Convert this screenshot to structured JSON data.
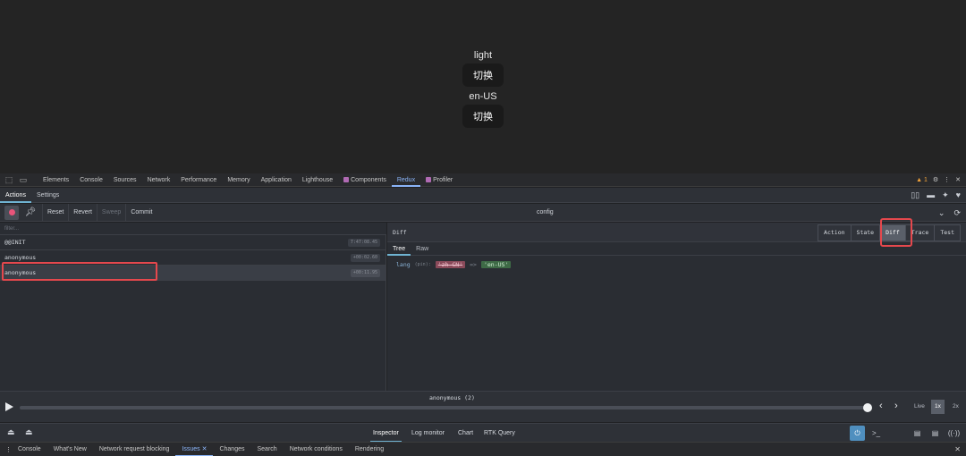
{
  "preview": {
    "theme_label": "light",
    "theme_button": "切换",
    "lang_label": "en-US",
    "lang_button": "切换"
  },
  "devtools_tabs": [
    "Elements",
    "Console",
    "Sources",
    "Network",
    "Performance",
    "Memory",
    "Application",
    "Lighthouse",
    "Components",
    "Redux",
    "Profiler"
  ],
  "devtools_right": {
    "warning_count": "1"
  },
  "redux_tabs": {
    "actions": "Actions",
    "settings": "Settings"
  },
  "toolbar": {
    "reset": "Reset",
    "revert": "Revert",
    "sweep": "Sweep",
    "commit": "Commit",
    "instance": "config"
  },
  "actions": {
    "filter_placeholder": "filter...",
    "items": [
      {
        "name": "@@INIT",
        "time": "7:47:08.45"
      },
      {
        "name": "anonymous",
        "time": "+00:02.60"
      },
      {
        "name": "anonymous",
        "time": "+00:11.95"
      }
    ]
  },
  "diff": {
    "title": "Diff",
    "modes": [
      "Action",
      "State",
      "Diff",
      "Trace",
      "Test"
    ],
    "subtabs": {
      "tree": "Tree",
      "raw": "Raw"
    },
    "line": {
      "key": "lang",
      "kind": "(pin):",
      "old": "'zh-CN'",
      "arrow": "=>",
      "new": "'en-US'"
    }
  },
  "slider": {
    "current_action": "anonymous (2)",
    "live": "Live",
    "speed_1x": "1x",
    "speed_2x": "2x",
    "position_fraction": 1.0
  },
  "monitors": [
    "Inspector",
    "Log monitor",
    "Chart",
    "RTK Query"
  ],
  "drawer_tabs": [
    "Console",
    "What's New",
    "Network request blocking",
    "Issues",
    "Changes",
    "Search",
    "Network conditions",
    "Rendering"
  ],
  "colors": {
    "accent": "#8ab4f8",
    "highlight": "#e5484d",
    "record": "#e8547a"
  }
}
